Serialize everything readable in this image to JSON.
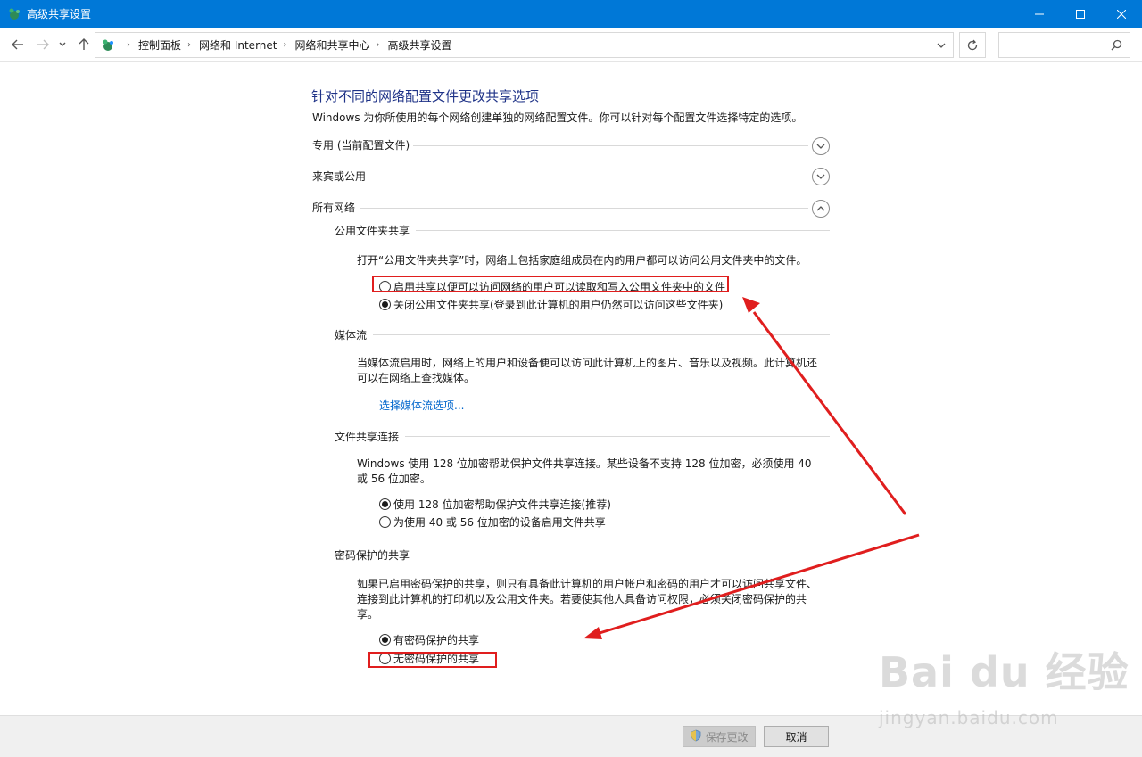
{
  "window": {
    "title": "高级共享设置",
    "accent": "#0078d7"
  },
  "breadcrumbs": [
    "控制面板",
    "网络和 Internet",
    "网络和共享中心",
    "高级共享设置"
  ],
  "search": {
    "placeholder": ""
  },
  "page": {
    "heading": "针对不同的网络配置文件更改共享选项",
    "description": "Windows 为你所使用的每个网络创建单独的网络配置文件。你可以针对每个配置文件选择特定的选项。"
  },
  "profiles": {
    "private": "专用 (当前配置文件)",
    "guest": "来宾或公用",
    "all": "所有网络"
  },
  "public_folder": {
    "title": "公用文件夹共享",
    "description": "打开“公用文件夹共享”时，网络上包括家庭组成员在内的用户都可以访问公用文件夹中的文件。",
    "option_on": "启用共享以便可以访问网络的用户可以读取和写入公用文件夹中的文件",
    "option_off": "关闭公用文件夹共享(登录到此计算机的用户仍然可以访问这些文件夹)"
  },
  "media": {
    "title": "媒体流",
    "description": "当媒体流启用时，网络上的用户和设备便可以访问此计算机上的图片、音乐以及视频。此计算机还可以在网络上查找媒体。",
    "link": "选择媒体流选项..."
  },
  "file_sharing": {
    "title": "文件共享连接",
    "description": "Windows 使用 128 位加密帮助保护文件共享连接。某些设备不支持 128 位加密，必须使用 40 或 56 位加密。",
    "option_128": "使用 128 位加密帮助保护文件共享连接(推荐)",
    "option_40_56": "为使用 40 或 56 位加密的设备启用文件共享"
  },
  "password": {
    "title": "密码保护的共享",
    "description": "如果已启用密码保护的共享，则只有具备此计算机的用户帐户和密码的用户才可以访问共享文件、连接到此计算机的打印机以及公用文件夹。若要使其他人具备访问权限，必须关闭密码保护的共享。",
    "option_on": "有密码保护的共享",
    "option_off": "无密码保护的共享"
  },
  "footer": {
    "save_label": "保存更改",
    "cancel_label": "取消"
  },
  "watermark": {
    "main": "Bai du 经验",
    "sub": "jingyan.baidu.com"
  },
  "annotation_color": "#e01e1e"
}
